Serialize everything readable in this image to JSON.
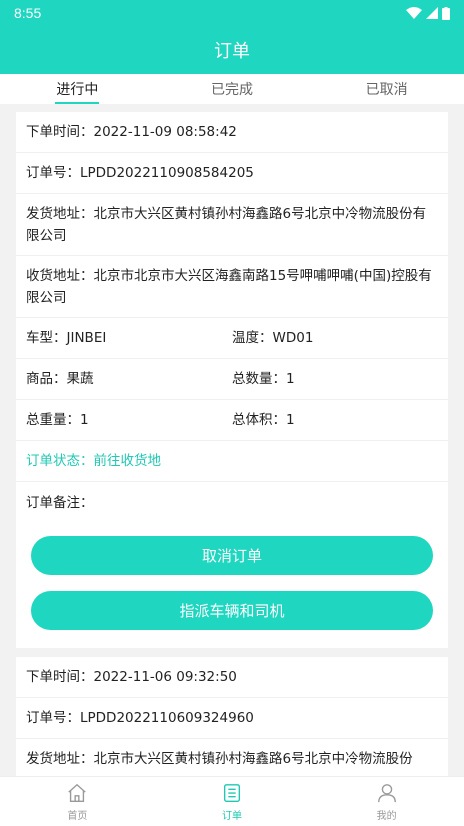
{
  "status_bar": {
    "time": "8:55"
  },
  "app_bar": {
    "title": "订单"
  },
  "tabs": [
    {
      "label": "进行中"
    },
    {
      "label": "已完成"
    },
    {
      "label": "已取消"
    }
  ],
  "orders": [
    {
      "order_time": "下单时间：2022-11-09 08:58:42",
      "order_no": "订单号：LPDD2022110908584205",
      "ship_address": "发货地址：北京市大兴区黄村镇孙村海鑫路6号北京中冷物流股份有限公司",
      "receive_address": "收货地址：北京市北京市大兴区海鑫南路15号呷哺呷哺(中国)控股有限公司",
      "vehicle_type": "车型：JINBEI",
      "temperature": "温度：WD01",
      "goods": "商品：果蔬",
      "total_qty": "总数量：1",
      "total_weight": "总重量：1",
      "total_volume": "总体积：1",
      "status_label": "订单状态：",
      "status_value": "前往收货地",
      "remark": "订单备注：",
      "cancel_button": "取消订单",
      "assign_button": "指派车辆和司机"
    },
    {
      "order_time": "下单时间：2022-11-06 09:32:50",
      "order_no": "订单号：LPDD2022110609324960",
      "ship_address": "发货地址：北京市大兴区黄村镇孙村海鑫路6号北京中冷物流股份"
    }
  ],
  "bottom_nav": [
    {
      "label": "首页",
      "icon": "home-icon"
    },
    {
      "label": "订单",
      "icon": "order-list-icon"
    },
    {
      "label": "我的",
      "icon": "person-icon"
    }
  ],
  "colors": {
    "accent": "#1fd6c0"
  }
}
